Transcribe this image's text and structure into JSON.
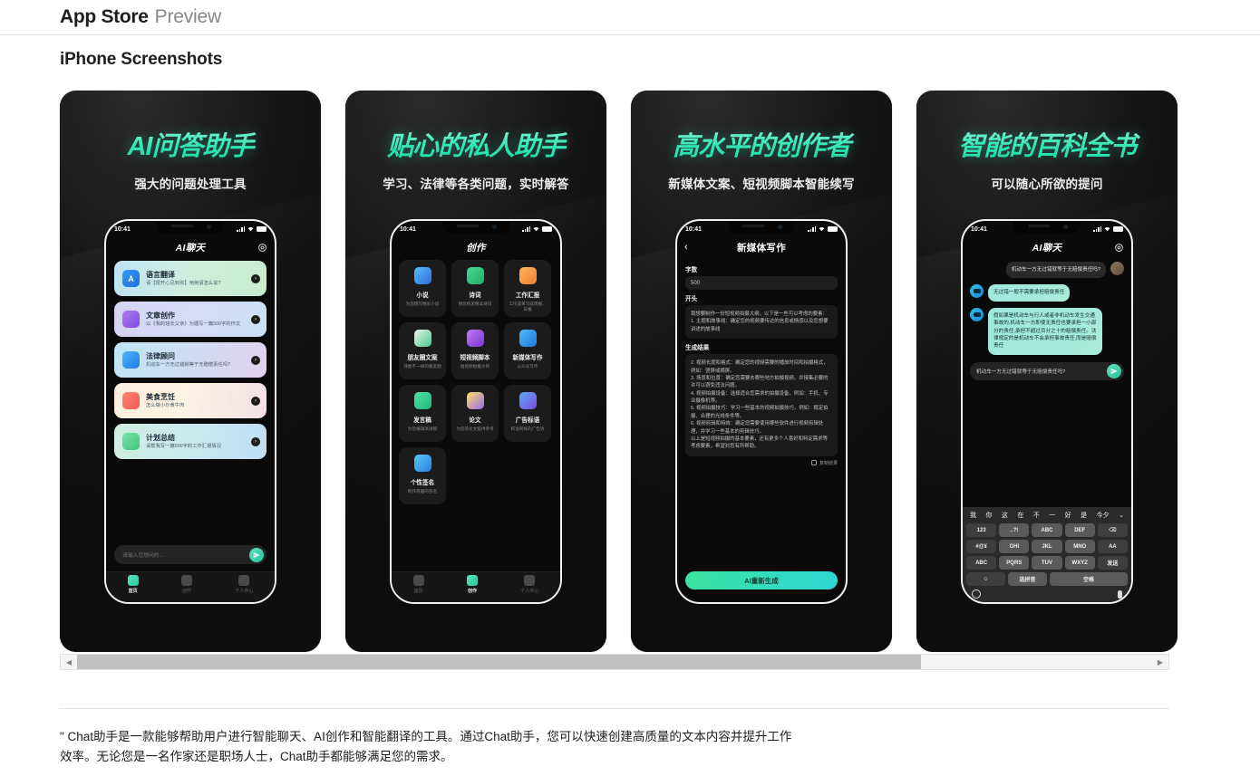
{
  "header": {
    "brand": "App Store",
    "preview": "Preview"
  },
  "section": {
    "title": "iPhone Screenshots"
  },
  "colors": {
    "accent_green": "#2de6b4",
    "card_dark": "#121212",
    "scrollbar_thumb": "#c0c0c0"
  },
  "statusbar": {
    "time": "10:41",
    "signal_icon": "cellular-bars-icon",
    "wifi_icon": "wifi-icon",
    "battery_icon": "battery-icon"
  },
  "screenshots": [
    {
      "title": "AI问答助手",
      "subtitle": "强大的问题处理工具",
      "nav_title": "AI聊天",
      "cards": [
        {
          "name": "语言翻译",
          "desc": "请【很开心见到你】用英语怎么说?",
          "icon": "translate-icon"
        },
        {
          "name": "文章创作",
          "desc": "以《我的班长父亲》为题写一篇500字的作文",
          "icon": "pencil-doc-icon"
        },
        {
          "name": "法律顾问",
          "desc": "机动车一方无过错就等于无赔偿责任吗?",
          "icon": "law-icon"
        },
        {
          "name": "美食烹饪",
          "desc": "怎么做小炒黄牛肉",
          "icon": "food-icon"
        },
        {
          "name": "计划总结",
          "desc": "请帮我写一篇500字的工作汇报情况",
          "icon": "plan-icon"
        }
      ],
      "input_placeholder": "请输入您想问的...",
      "send_icon": "send-paper-plane-icon",
      "tabs": [
        {
          "label": "首页",
          "icon": "home-icon",
          "active": true
        },
        {
          "label": "创作",
          "icon": "create-icon",
          "active": false
        },
        {
          "label": "个人中心",
          "icon": "profile-icon",
          "active": false
        }
      ]
    },
    {
      "title": "贴心的私人助手",
      "subtitle": "学习、法律等各类问题，实时解答",
      "nav_title": "创作",
      "tiles": [
        {
          "name": "小说",
          "desc": "为您撰写精彩小说",
          "icon": "novel-icon"
        },
        {
          "name": "诗词",
          "desc": "替您构思精美诗词",
          "icon": "poem-icon"
        },
        {
          "name": "工作汇报",
          "desc": "工作成果写成周报、日报",
          "icon": "report-icon"
        },
        {
          "name": "朋友圈文案",
          "desc": "律能不一样的朋友圈",
          "icon": "moments-icon"
        },
        {
          "name": "短视频脚本",
          "desc": "短视频拍摄大师",
          "icon": "video-script-icon"
        },
        {
          "name": "新媒体写作",
          "desc": "公众号写作",
          "icon": "media-write-icon"
        },
        {
          "name": "发言稿",
          "desc": "为您编辑演讲稿",
          "icon": "speech-icon"
        },
        {
          "name": "论文",
          "desc": "为您的论文提供参考",
          "icon": "thesis-icon"
        },
        {
          "name": "广告标语",
          "desc": "校准同样的广告语",
          "icon": "ad-icon"
        },
        {
          "name": "个性签名",
          "desc": "制作有趣的签名",
          "icon": "signature-icon"
        }
      ],
      "tabs": [
        {
          "label": "首页",
          "icon": "home-icon",
          "active": false
        },
        {
          "label": "创作",
          "icon": "create-icon",
          "active": true
        },
        {
          "label": "个人中心",
          "icon": "profile-icon",
          "active": false
        }
      ]
    },
    {
      "title": "高水平的创作者",
      "subtitle": "新媒体文案、短视频脚本智能续写",
      "nav_title": "新媒体写作",
      "back_icon": "chevron-left-icon",
      "word_count_label": "字数",
      "word_count_value": "500",
      "opening_label": "开头",
      "opening_text": "我想要制作一份短视频拍摄大纲，以下是一些可以考虑的要素：\n1. 主题和故事线：确定您的视频要传达的信息或情感以及您想要讲述的故事线",
      "result_label": "生成结果",
      "result_text": "2. 视频长度和格式：确定您的视频需要的播放时间和拍摄格式，例如：竖屏或横屏。\n3. 场景和位置：确定您需要去哪些地方拍摄视频，并接集必要的许可以避免违法问题。\n4. 视频拍摄设备：选择适合您需求的拍摄设备，例如：手机、专业摄像机等。\n5. 视频拍摄技巧：学习一些基本的视频拍摄技巧，例如：稳定拍摄、合理的光线条件等。\n6. 视频剪辑和特效：确定您需要使用哪些软件进行视频剪辑处理，并学习一些基本的剪辑技巧。\n以上是短视频拍摄的基本要素，还有更多个人喜好和特定需求等考虑要素，希望对您有所帮助。",
      "copy_label": "复制结果",
      "copy_icon": "copy-icon",
      "regen_label": "AI重新生成"
    },
    {
      "title": "智能的百科全书",
      "subtitle": "可以随心所欲的提问",
      "nav_title": "AI聊天",
      "messages": [
        {
          "from": "me",
          "text": "机动车一方无过错就等于无赔偿责任吗?",
          "avatar": "user-avatar"
        },
        {
          "from": "bot",
          "text": "无过错一般不需要承担赔偿责任",
          "avatar": "bot-avatar"
        },
        {
          "from": "bot",
          "text": "假如果是机动车与行人或者非机动车发生交通事故的,机动车一方即使无责任也要承担一小部分的责任,承担不超过百分之十的赔偿责任。法律规定的是机动车不会承担事故责任,而是赔偿责任",
          "avatar": "bot-avatar"
        }
      ],
      "input_value": "机动车一方无过错就等于无赔偿责任吗?",
      "send_icon": "send-paper-plane-icon",
      "keyboard": {
        "suggestions": [
          "我",
          "你",
          "这",
          "在",
          "不",
          "一",
          "好",
          "是",
          "今夕"
        ],
        "expand_icon": "chevron-down-icon",
        "rows": [
          [
            "123",
            "..?!",
            "ABC",
            "DEF",
            "⌫"
          ],
          [
            "#@¥",
            "GHI",
            "JKL",
            "MNO",
            "AA"
          ],
          [
            "ABC",
            "PQRS",
            "TUV",
            "WXYZ",
            "发送"
          ],
          [
            "☺",
            "选拼音",
            "空格"
          ]
        ],
        "globe_icon": "globe-icon",
        "mic_icon": "microphone-icon"
      }
    }
  ],
  "scrollbar": {
    "left_arrow_icon": "chevron-left-icon",
    "right_arrow_icon": "chevron-right-icon"
  },
  "description": "\" Chat助手是一款能够帮助用户进行智能聊天、AI创作和智能翻译的工具。通过Chat助手，您可以快速创建高质量的文本内容并提升工作效率。无论您是一名作家还是职场人士，Chat助手都能够满足您的需求。"
}
